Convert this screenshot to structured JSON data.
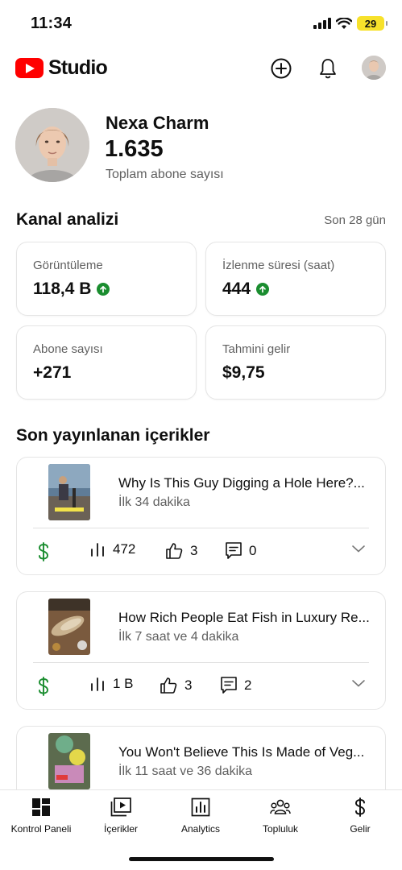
{
  "status_bar": {
    "time": "11:34",
    "battery": "29"
  },
  "header": {
    "logo_text": "Studio"
  },
  "channel": {
    "name": "Nexa Charm",
    "subscribers": "1.635",
    "subscribers_label": "Toplam abone sayısı"
  },
  "analytics": {
    "title": "Kanal analizi",
    "range": "Son 28 gün",
    "cards": [
      {
        "label": "Görüntüleme",
        "value": "118,4 B",
        "trend": "up"
      },
      {
        "label": "İzlenme süresi (saat)",
        "value": "444",
        "trend": "up"
      },
      {
        "label": "Abone sayısı",
        "value": "+271"
      },
      {
        "label": "Tahmini gelir",
        "value": "$9,75"
      }
    ]
  },
  "recent": {
    "title": "Son yayınlanan içerikler",
    "items": [
      {
        "title": "Why Is This Guy Digging a Hole Here?...",
        "age": "İlk 34 dakika",
        "views": "472",
        "likes": "3",
        "comments": "0"
      },
      {
        "title": "How Rich People Eat Fish in Luxury Re...",
        "age": "İlk 7 saat ve 4 dakika",
        "views": "1 B",
        "likes": "3",
        "comments": "2"
      },
      {
        "title": "You Won't Believe This Is Made of Veg...",
        "age": "İlk 11 saat ve 36 dakika"
      }
    ]
  },
  "bottom_nav": {
    "items": [
      {
        "label": "Kontrol Paneli",
        "icon": "dashboard-icon"
      },
      {
        "label": "İçerikler",
        "icon": "content-icon"
      },
      {
        "label": "Analytics",
        "icon": "analytics-icon"
      },
      {
        "label": "Topluluk",
        "icon": "community-icon"
      },
      {
        "label": "Gelir",
        "icon": "earn-icon"
      }
    ]
  },
  "colors": {
    "brand_red": "#ff0000",
    "trend_green": "#1a8d2f",
    "monetization_green": "#1a8d2f",
    "battery_yellow": "#f7e12b"
  }
}
